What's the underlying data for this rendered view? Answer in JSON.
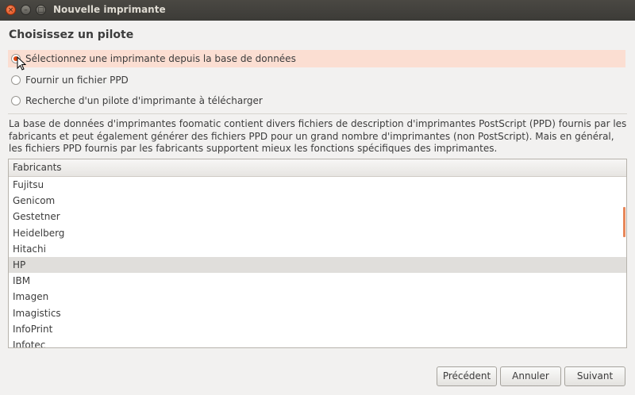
{
  "window": {
    "title": "Nouvelle imprimante",
    "close_glyph": "×",
    "minimize_glyph": "–",
    "maximize_glyph": "□"
  },
  "page": {
    "heading": "Choisissez un pilote"
  },
  "options": [
    {
      "label": "Sélectionnez une imprimante depuis la base de données",
      "selected": true
    },
    {
      "label": "Fournir un fichier PPD",
      "selected": false
    },
    {
      "label": "Recherche d'un pilote d'imprimante à télécharger",
      "selected": false
    }
  ],
  "description": "La base de données d'imprimantes foomatic contient divers fichiers de description d'imprimantes PostScript (PPD) fournis par les fabricants et peut également générer des fichiers PPD pour un grand nombre d'imprimantes (non PostScript). Mais en général, les fichiers PPD fournis par les fabricants supportent mieux les fonctions spécifiques des imprimantes.",
  "manufacturers": {
    "column_header": "Fabricants",
    "items": [
      "Fujitsu",
      "Genicom",
      "Gestetner",
      "Heidelberg",
      "Hitachi",
      "HP",
      "IBM",
      "Imagen",
      "Imagistics",
      "InfoPrint",
      "Infotec"
    ],
    "selected": "HP"
  },
  "buttons": {
    "previous": "Précédent",
    "cancel": "Annuler",
    "next": "Suivant"
  },
  "colors": {
    "accent": "#dd4814",
    "selection_highlight": "#fbded2",
    "titlebar": "#3c3b37"
  }
}
